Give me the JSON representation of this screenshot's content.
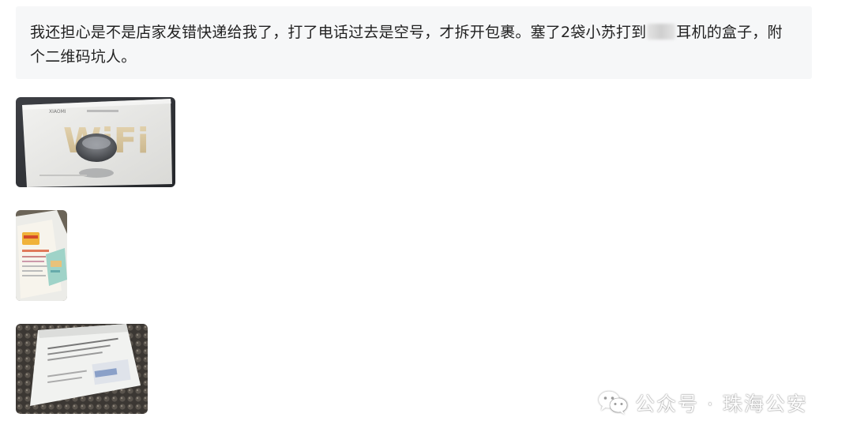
{
  "post": {
    "text_before_redaction": "我还担心是不是店家发错快递给我了，打了电话过去是空号，才拆开包裹。塞了2袋小苏打到",
    "text_after_redaction": "耳机的盒子，附个二维码坑人。"
  },
  "photos": [
    {
      "id": "earbuds-box",
      "box_brand_text": "XIAOMI",
      "box_big_text": "WiFi"
    },
    {
      "id": "baking-soda-bags"
    },
    {
      "id": "package-label"
    }
  ],
  "watermark": {
    "text": "公众号 · 珠海公安",
    "icon": "wechat-icon"
  }
}
